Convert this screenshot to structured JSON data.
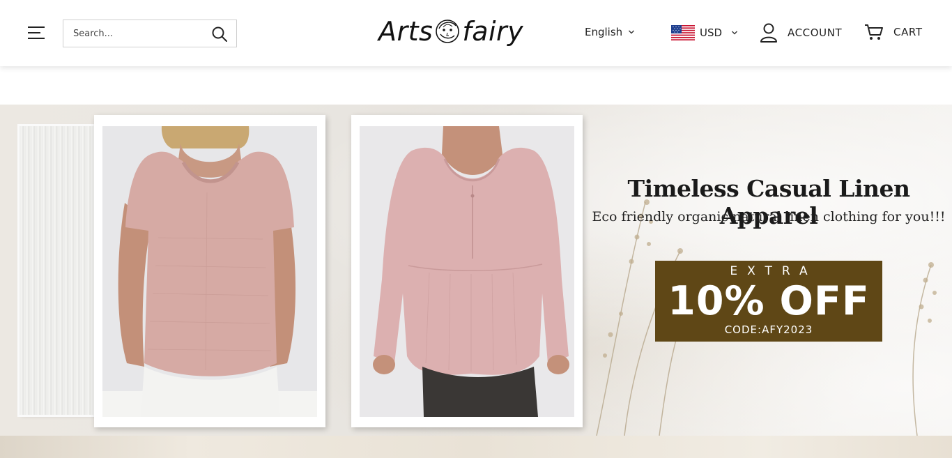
{
  "header": {
    "menu_icon": "hamburger-menu-icon",
    "search": {
      "placeholder": "Search...",
      "value": "",
      "icon": "search-icon"
    },
    "logo": {
      "text_left": "Arts",
      "text_right": "fairy",
      "mark_icon": "fairy-face-icon"
    },
    "language": {
      "label": "English",
      "icon": "chevron-down-icon"
    },
    "currency": {
      "label": "USD",
      "flag": "us-flag-icon",
      "icon": "chevron-down-icon"
    },
    "account": {
      "label": "ACCOUNT",
      "icon": "user-icon"
    },
    "cart": {
      "label": "CART",
      "icon": "cart-icon"
    }
  },
  "hero": {
    "title": "Timeless Casual Linen Apparel",
    "subtitle": "Eco friendly organic natural linen clothing for you!!!",
    "promo": {
      "extra": "EXTRA",
      "headline": "10% OFF",
      "code": "CODE:AFY2023",
      "background": "#5f4716"
    },
    "products": [
      {
        "name": "short-sleeve-linen-top",
        "color": "#d9aea9"
      },
      {
        "name": "long-sleeve-linen-blouse",
        "color": "#ddb3b2"
      }
    ]
  },
  "colors": {
    "text": "#222222",
    "promo": "#5f4716",
    "header_bg": "#ffffff"
  }
}
